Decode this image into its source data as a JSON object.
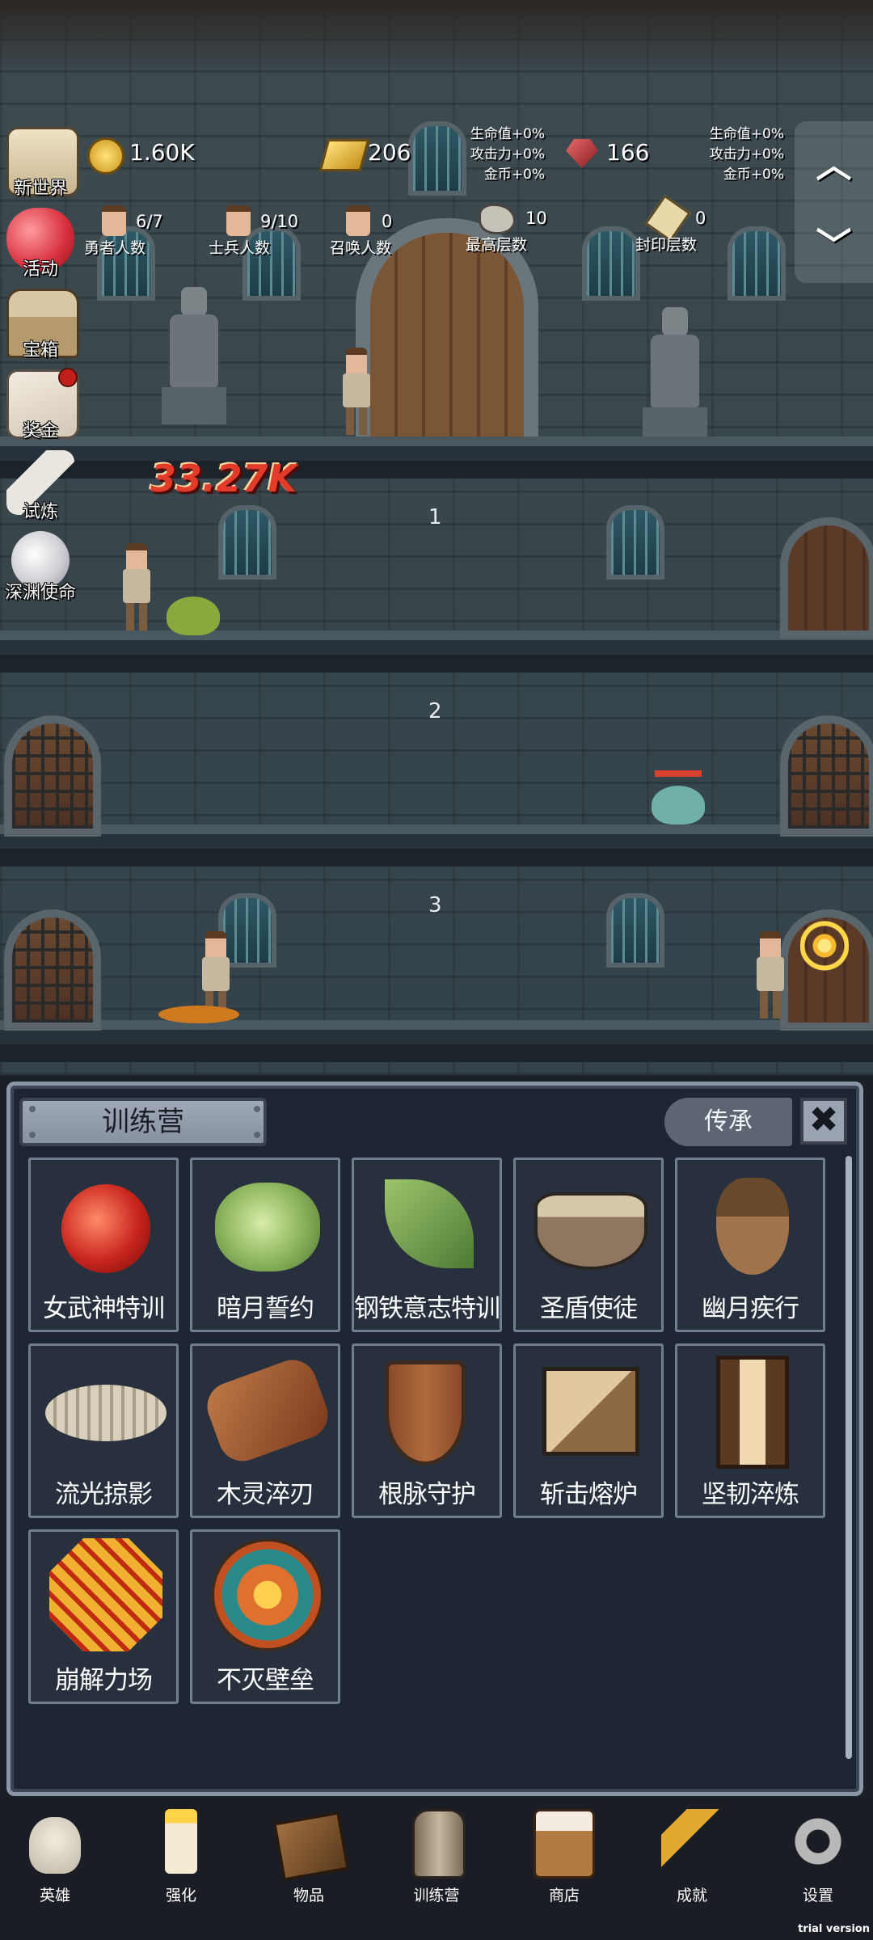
{
  "hud": {
    "gold": "1.60K",
    "gold_bar": "206",
    "gem": "166",
    "buff_left": [
      "生命值+0%",
      "攻击力+0%",
      "金币+0%"
    ],
    "buff_right": [
      "生命值+0%",
      "攻击力+0%",
      "金币+0%"
    ],
    "stats": [
      {
        "value": "6/7",
        "label": "勇者人数"
      },
      {
        "value": "9/10",
        "label": "士兵人数"
      },
      {
        "value": "0",
        "label": "召唤人数"
      },
      {
        "value": "10",
        "label": "最高层数"
      },
      {
        "value": "0",
        "label": "封印层数"
      }
    ],
    "arrow_up": "︿",
    "arrow_down": "﹀"
  },
  "side_menu": [
    {
      "label": "新世界",
      "icon": "scroll-map-icon"
    },
    {
      "label": "活动",
      "icon": "heart-icon"
    },
    {
      "label": "宝箱",
      "icon": "treasure-chest-icon"
    },
    {
      "label": "奖金",
      "icon": "envelope-icon",
      "badge": true
    },
    {
      "label": "试炼",
      "icon": "feather-icon"
    },
    {
      "label": "深渊使命",
      "icon": "pearl-icon"
    }
  ],
  "scene": {
    "floors": [
      "1",
      "2",
      "3"
    ],
    "damage_text": "33.27K"
  },
  "panel": {
    "title": "训练营",
    "inherit_label": "传承",
    "close_label": "✖",
    "items": [
      {
        "name": "女武神特训",
        "icon": "apple-icon"
      },
      {
        "name": "暗月誓约",
        "icon": "cabbage-icon"
      },
      {
        "name": "钢铁意志特训",
        "icon": "leaf-icon"
      },
      {
        "name": "圣盾使徒",
        "icon": "porridge-bowl-icon"
      },
      {
        "name": "幽月疾行",
        "icon": "acorn-icon"
      },
      {
        "name": "流光掠影",
        "icon": "fish-fossil-icon"
      },
      {
        "name": "木灵淬刃",
        "icon": "log-icon"
      },
      {
        "name": "根脉守护",
        "icon": "wooden-shield-icon"
      },
      {
        "name": "斩击熔炉",
        "icon": "crate-icon"
      },
      {
        "name": "坚韧淬炼",
        "icon": "tall-shield-icon"
      },
      {
        "name": "崩解力场",
        "icon": "lava-shield-icon"
      },
      {
        "name": "不灭壁垒",
        "icon": "sun-shield-icon"
      }
    ]
  },
  "bottom_nav": [
    {
      "label": "英雄",
      "icon": "skull-icon"
    },
    {
      "label": "强化",
      "icon": "candle-icon"
    },
    {
      "label": "物品",
      "icon": "book-icon"
    },
    {
      "label": "训练营",
      "icon": "lantern-icon"
    },
    {
      "label": "商店",
      "icon": "beer-mug-icon"
    },
    {
      "label": "成就",
      "icon": "key-icon"
    },
    {
      "label": "设置",
      "icon": "gear-icon"
    }
  ],
  "watermark": "trial version"
}
